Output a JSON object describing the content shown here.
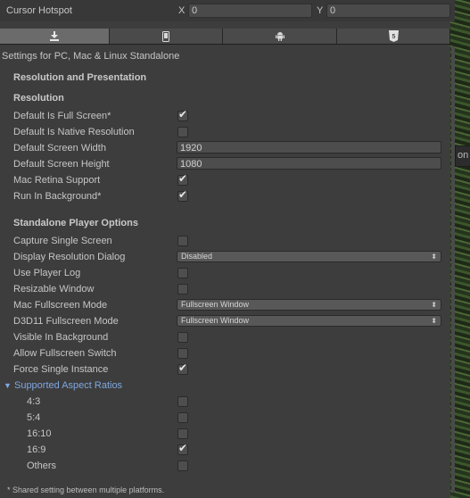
{
  "hotspot": {
    "label": "Cursor Hotspot",
    "x_label": "X",
    "x_value": "0",
    "y_label": "Y",
    "y_value": "0"
  },
  "tabs": [
    {
      "icon": "download-icon",
      "selected": true
    },
    {
      "icon": "phone-icon",
      "selected": false
    },
    {
      "icon": "android-icon",
      "selected": false
    },
    {
      "icon": "html5-icon",
      "selected": false
    }
  ],
  "settings_title": "Settings for PC, Mac & Linux Standalone",
  "section": {
    "title": "Resolution and Presentation"
  },
  "resolution": {
    "title": "Resolution",
    "default_full_screen": {
      "label": "Default Is Full Screen*",
      "checked": true
    },
    "default_native": {
      "label": "Default Is Native Resolution",
      "checked": false
    },
    "screen_width": {
      "label": "Default Screen Width",
      "value": "1920"
    },
    "screen_height": {
      "label": "Default Screen Height",
      "value": "1080"
    },
    "mac_retina": {
      "label": "Mac Retina Support",
      "checked": true
    },
    "run_in_background": {
      "label": "Run In Background*",
      "checked": true
    }
  },
  "standalone": {
    "title": "Standalone Player Options",
    "capture_single_screen": {
      "label": "Capture Single Screen",
      "checked": false
    },
    "display_resolution_dialog": {
      "label": "Display Resolution Dialog",
      "value": "Disabled"
    },
    "use_player_log": {
      "label": "Use Player Log",
      "checked": false
    },
    "resizable_window": {
      "label": "Resizable Window",
      "checked": false
    },
    "mac_fullscreen_mode": {
      "label": "Mac Fullscreen Mode",
      "value": "Fullscreen Window"
    },
    "d3d11_fullscreen_mode": {
      "label": "D3D11 Fullscreen Mode",
      "value": "Fullscreen Window"
    },
    "visible_in_background": {
      "label": "Visible In Background",
      "checked": false
    },
    "allow_fullscreen_switch": {
      "label": "Allow Fullscreen Switch",
      "checked": false
    },
    "force_single_instance": {
      "label": "Force Single Instance",
      "checked": true
    }
  },
  "aspect_ratios": {
    "label": "Supported Aspect Ratios",
    "expanded": true,
    "items": [
      {
        "label": "4:3",
        "checked": false
      },
      {
        "label": "5:4",
        "checked": false
      },
      {
        "label": "16:10",
        "checked": false
      },
      {
        "label": "16:9",
        "checked": true
      },
      {
        "label": "Others",
        "checked": false
      }
    ]
  },
  "footnote": "* Shared setting between multiple platforms.",
  "colors": {
    "background": "#3d3d3d",
    "foldout": "#7fa6e0",
    "text": "#c6c6c6"
  },
  "glyphs": {
    "tick": "✔",
    "foldout_arrow": "▼",
    "dropdown_arrows": "⬍"
  }
}
